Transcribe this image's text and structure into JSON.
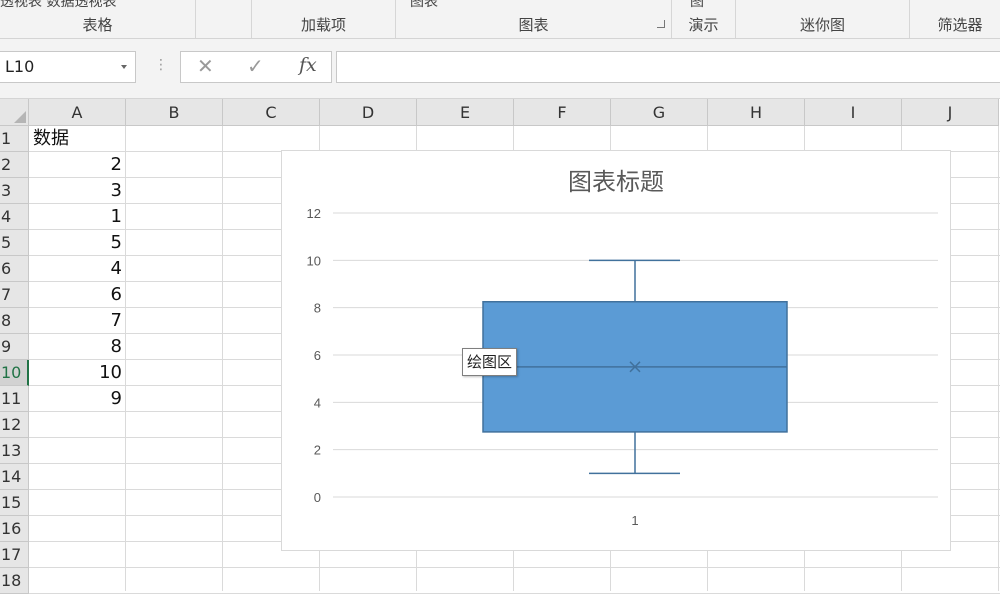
{
  "ribbon": {
    "top_cut_text": "透视表 数据透视表",
    "top_cut_icon_text_1": "图表",
    "top_cut_icon_text_2": "图",
    "groups": [
      {
        "label": "表格"
      },
      {
        "label": ""
      },
      {
        "label": "加载项"
      },
      {
        "label": "图表"
      },
      {
        "label": "演示"
      },
      {
        "label": "迷你图"
      },
      {
        "label": "筛选器"
      }
    ]
  },
  "formula_bar": {
    "name_box": "L10",
    "cancel_icon": "close-icon",
    "enter_icon": "check-icon",
    "fx_label": "fx",
    "formula_value": ""
  },
  "sheet": {
    "columns": [
      "A",
      "B",
      "C",
      "D",
      "E",
      "F",
      "G",
      "H",
      "I",
      "J"
    ],
    "rows": [
      "1",
      "2",
      "3",
      "4",
      "5",
      "6",
      "7",
      "8",
      "9",
      "10",
      "11",
      "12",
      "13",
      "14",
      "15",
      "16",
      "17",
      "18"
    ],
    "active_row": "10",
    "cells": {
      "A1": "数据",
      "A2": "2",
      "A3": "3",
      "A4": "1",
      "A5": "5",
      "A6": "4",
      "A7": "6",
      "A8": "7",
      "A9": "8",
      "A10": "10",
      "A11": "9"
    }
  },
  "chart": {
    "title": "图表标题",
    "plot_area_tooltip": "绘图区",
    "box_color": "#5b9bd5",
    "line_color": "#41719c",
    "gridline_color": "#d9d9d9"
  },
  "chart_data": {
    "type": "boxplot",
    "title": "图表标题",
    "categories": [
      "1"
    ],
    "values": [
      2,
      3,
      1,
      5,
      4,
      6,
      7,
      8,
      10,
      9
    ],
    "stats": {
      "min": 1,
      "q1": 2.75,
      "median": 5.5,
      "mean": 5.5,
      "q3": 8.25,
      "max": 10
    },
    "ylim": [
      0,
      12
    ],
    "y_ticks": [
      0,
      2,
      4,
      6,
      8,
      10,
      12
    ],
    "grid": true,
    "legend": "none"
  }
}
